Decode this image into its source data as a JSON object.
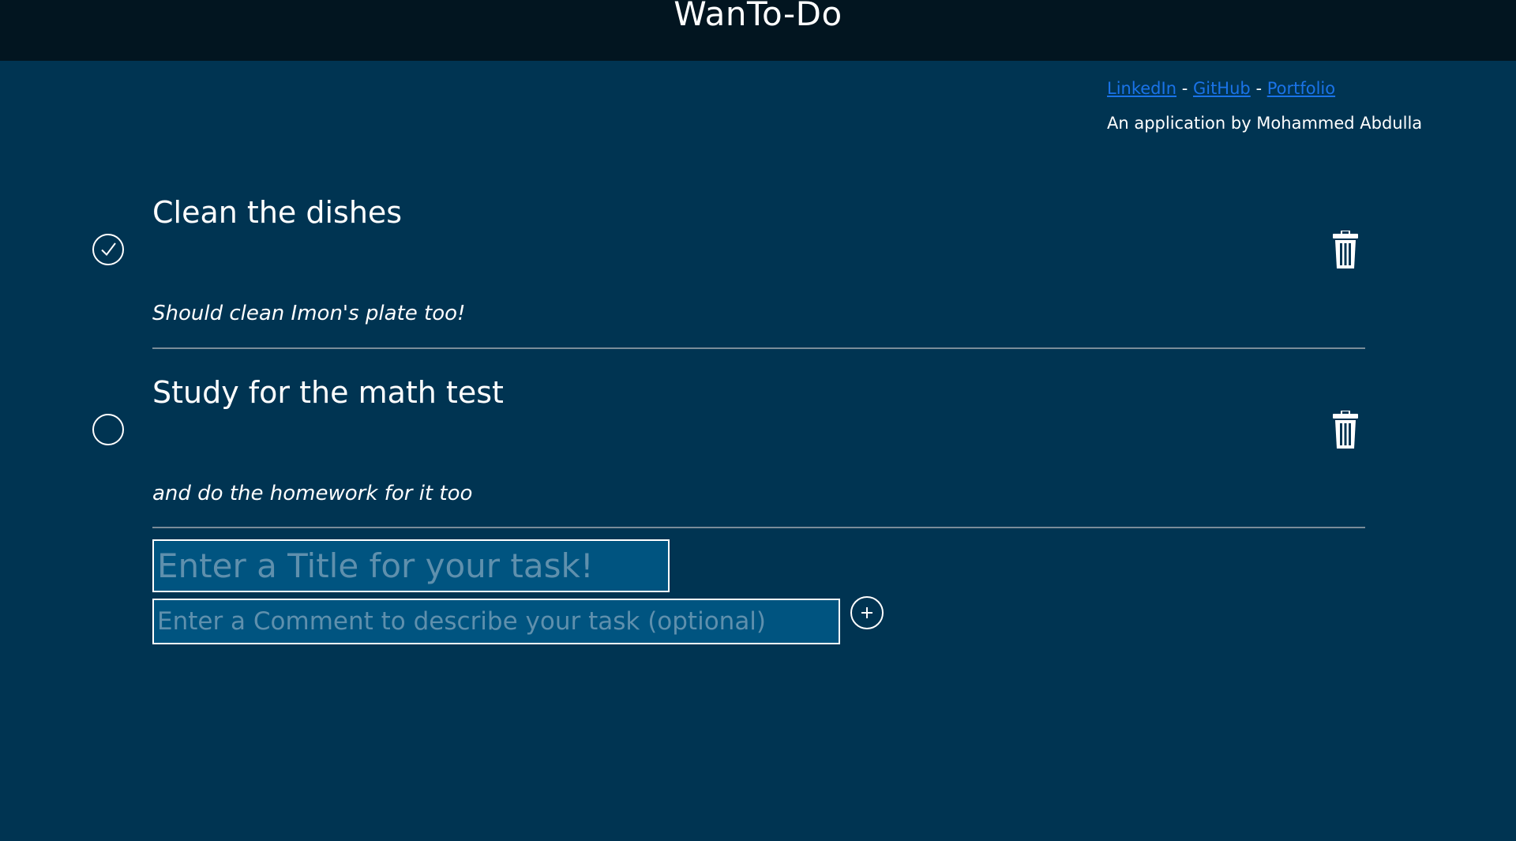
{
  "header": {
    "title": "WanTo-Do"
  },
  "credits": {
    "links": [
      {
        "label": "LinkedIn"
      },
      {
        "label": "GitHub"
      },
      {
        "label": "Portfolio"
      }
    ],
    "separator": "-",
    "byline": "An application by Mohammed Abdulla"
  },
  "tasks": [
    {
      "title": "Clean the dishes",
      "comment": "Should clean Imon's plate too!",
      "completed": true
    },
    {
      "title": "Study for the math test",
      "comment": "and do the homework for it too",
      "completed": false
    }
  ],
  "form": {
    "title_placeholder": "Enter a Title for your task!",
    "comment_placeholder": "Enter a Comment to describe your task (optional)",
    "title_value": "",
    "comment_value": ""
  },
  "icons": {
    "check": "check-icon",
    "trash": "trash-icon",
    "add": "plus-icon"
  },
  "colors": {
    "background": "#003452",
    "header_background": "#021520",
    "input_background": "#005480",
    "link": "#1a73e8",
    "divider": "#7a8c99",
    "placeholder": "#5f90ad"
  }
}
